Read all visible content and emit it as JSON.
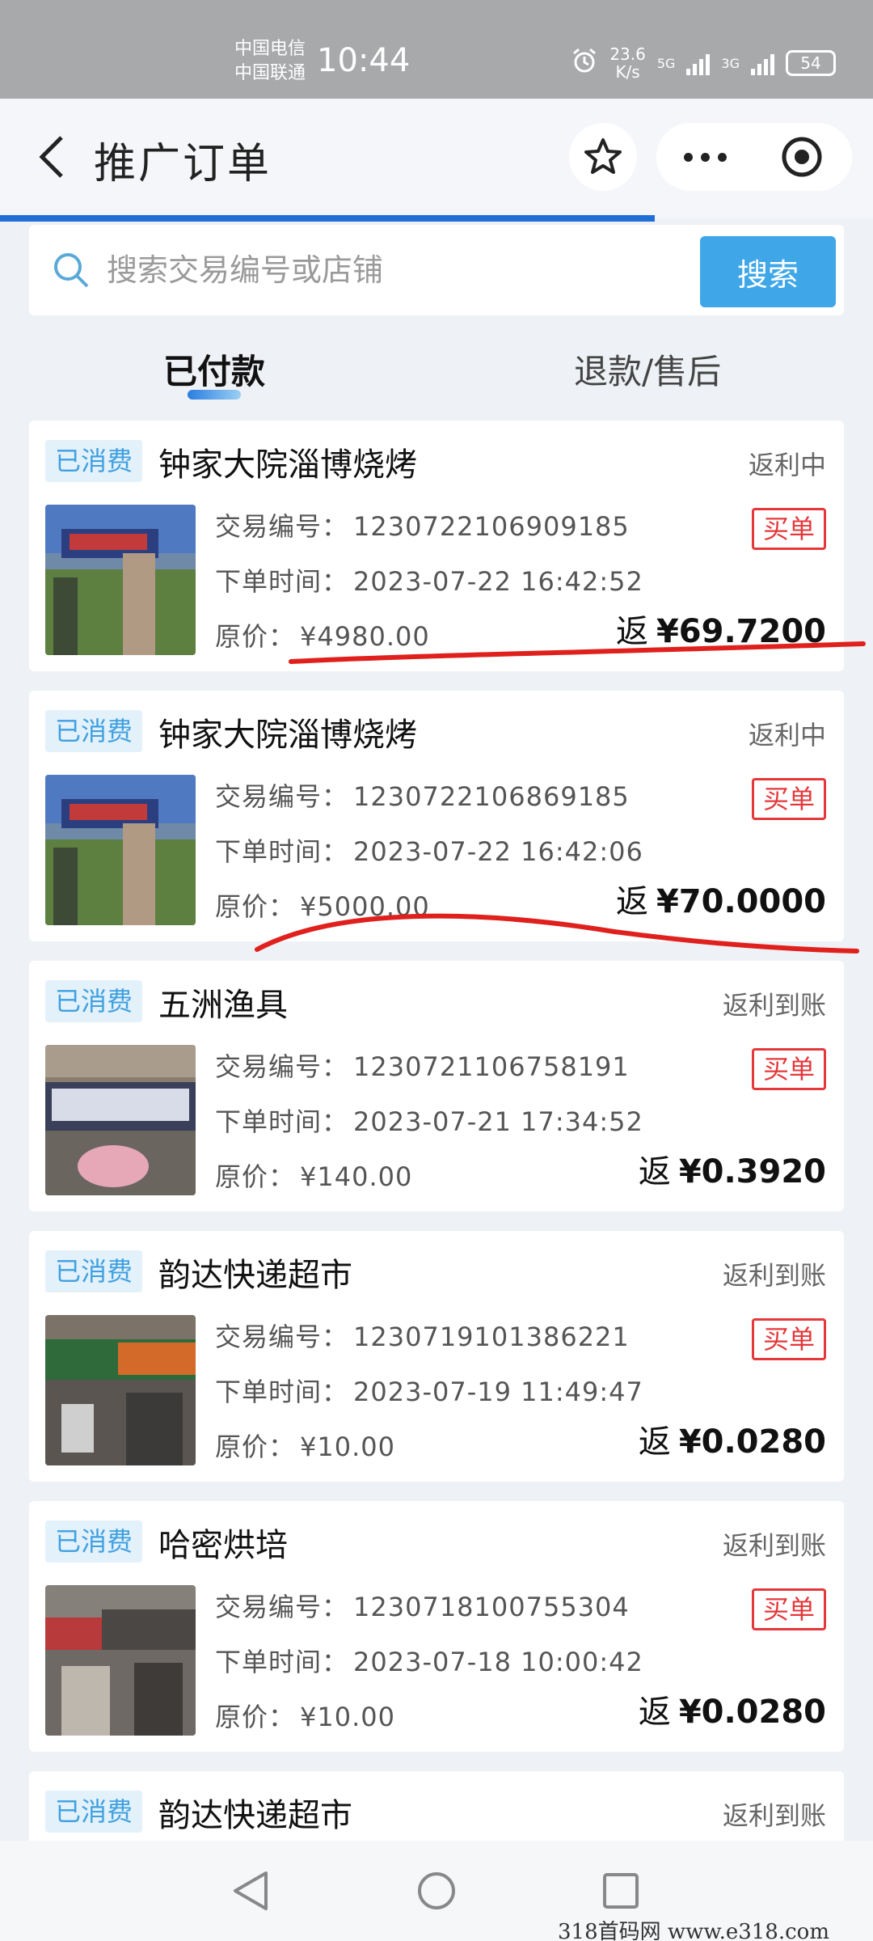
{
  "status_bar": {
    "carrier1": "中国电信",
    "carrier2": "中国联通",
    "time": "10:44",
    "speed_value": "23.6",
    "speed_unit": "K/s",
    "net1": "5G",
    "net2": "3G",
    "battery": "54"
  },
  "header": {
    "title": "推广订单"
  },
  "search": {
    "placeholder": "搜索交易编号或店铺",
    "button": "搜索"
  },
  "tabs": [
    {
      "label": "已付款",
      "active": true
    },
    {
      "label": "退款/售后",
      "active": false
    }
  ],
  "labels": {
    "txn": "交易编号：",
    "time": "下单时间：",
    "price": "原价：",
    "buy": "买单",
    "ret": "返"
  },
  "orders": [
    {
      "tag": "已消费",
      "shop": "钟家大院淄博烧烤",
      "status": "返利中",
      "txn": "1230722106909185",
      "time": "2023-07-22 16:42:52",
      "price": "¥4980.00",
      "rebate": "¥69.7200"
    },
    {
      "tag": "已消费",
      "shop": "钟家大院淄博烧烤",
      "status": "返利中",
      "txn": "1230722106869185",
      "time": "2023-07-22 16:42:06",
      "price": "¥5000.00",
      "rebate": "¥70.0000"
    },
    {
      "tag": "已消费",
      "shop": "五洲渔具",
      "status": "返利到账",
      "txn": "1230721106758191",
      "time": "2023-07-21 17:34:52",
      "price": "¥140.00",
      "rebate": "¥0.3920"
    },
    {
      "tag": "已消费",
      "shop": "韵达快递超市",
      "status": "返利到账",
      "txn": "1230719101386221",
      "time": "2023-07-19 11:49:47",
      "price": "¥10.00",
      "rebate": "¥0.0280"
    },
    {
      "tag": "已消费",
      "shop": "哈密烘培",
      "status": "返利到账",
      "txn": "1230718100755304",
      "time": "2023-07-18 10:00:42",
      "price": "¥10.00",
      "rebate": "¥0.0280"
    },
    {
      "tag": "已消费",
      "shop": "韵达快递超市",
      "status": "返利到账"
    }
  ],
  "watermark": "318首码网  www.e318.com",
  "colors": {
    "accent": "#3fa7e8",
    "tag_bg": "#e3f1fb",
    "buy_red": "#e5383b",
    "progress": "#1f6fd6"
  }
}
